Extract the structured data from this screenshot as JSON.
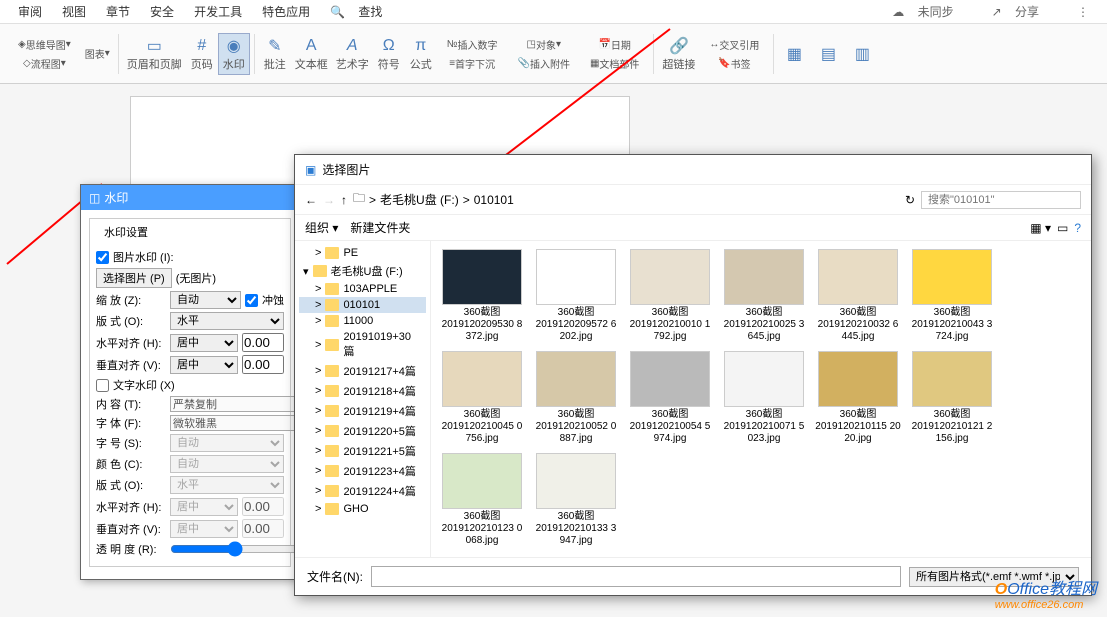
{
  "menu": {
    "items": [
      "审阅",
      "视图",
      "章节",
      "安全",
      "开发工具",
      "特色应用"
    ],
    "search": "查找",
    "right": [
      "未同步",
      "分享"
    ]
  },
  "toolbar": {
    "mindmap": "思维导图",
    "flowchart": "流程图",
    "charts": "图表",
    "header_footer": "页眉和页脚",
    "page_number": "页码",
    "watermark": "水印",
    "comment": "批注",
    "textbox": "文本框",
    "wordart": "艺术字",
    "symbol": "符号",
    "equation": "公式",
    "insert_num": "插入数字",
    "first_down": "首字下沉",
    "object": "对象",
    "insert_attach": "插入附件",
    "date": "日期",
    "doc_part": "文档部件",
    "hyperlink": "超链接",
    "cross_ref": "交叉引用",
    "bookmark": "书签"
  },
  "watermark_dialog": {
    "title": "水印",
    "settings_label": "水印设置",
    "img_watermark": "图片水印 (I):",
    "select_img": "选择图片 (P)",
    "no_img": "(无图片)",
    "scale": "缩 放 (Z):",
    "scale_val": "自动",
    "wash": "冲蚀",
    "layout": "版 式 (O):",
    "layout_val": "水平",
    "h_align": "水平对齐 (H):",
    "h_align_val": "居中",
    "h_offset": "0.00",
    "v_align": "垂直对齐 (V):",
    "v_align_val": "居中",
    "v_offset": "0.00",
    "txt_watermark": "文字水印 (X)",
    "content": "内 容 (T):",
    "content_val": "严禁复制",
    "font": "字 体 (F):",
    "font_val": "微软雅黑",
    "fontsize": "字 号 (S):",
    "fontsize_val": "自动",
    "color": "颜 色 (C):",
    "color_val": "自动",
    "layout2": "版 式 (O):",
    "layout2_val": "水平",
    "h_align2": "水平对齐 (H):",
    "h_align2_val": "居中",
    "h_offset2": "0.00",
    "v_align2": "垂直对齐 (V):",
    "v_align2_val": "居中",
    "v_offset2": "0.00",
    "opacity": "透 明 度 (R):"
  },
  "file_dialog": {
    "title": "选择图片",
    "path": [
      "老毛桃U盘 (F:)",
      "010101"
    ],
    "search_placeholder": "搜索\"010101\"",
    "organize": "组织",
    "new_folder": "新建文件夹",
    "tree": [
      {
        "label": "PE",
        "level": 1
      },
      {
        "label": "老毛桃U盘 (F:)",
        "level": 0,
        "root": true
      },
      {
        "label": "103APPLE",
        "level": 1
      },
      {
        "label": "010101",
        "level": 1,
        "selected": true
      },
      {
        "label": "11000",
        "level": 1
      },
      {
        "label": "20191019+30篇",
        "level": 1
      },
      {
        "label": "20191217+4篇",
        "level": 1
      },
      {
        "label": "20191218+4篇",
        "level": 1
      },
      {
        "label": "20191219+4篇",
        "level": 1
      },
      {
        "label": "20191220+5篇",
        "level": 1
      },
      {
        "label": "20191221+5篇",
        "level": 1
      },
      {
        "label": "20191223+4篇",
        "level": 1
      },
      {
        "label": "20191224+4篇",
        "level": 1
      },
      {
        "label": "GHO",
        "level": 1
      }
    ],
    "files": [
      {
        "title": "360截图",
        "name": "2019120209530 8372.jpg",
        "bg": "#1c2a38"
      },
      {
        "title": "360截图",
        "name": "2019120209572 6202.jpg",
        "bg": "#fff"
      },
      {
        "title": "360截图",
        "name": "2019120210010 1792.jpg",
        "bg": "#e8e0d0"
      },
      {
        "title": "360截图",
        "name": "2019120210025 3645.jpg",
        "bg": "#d4c8b0"
      },
      {
        "title": "360截图",
        "name": "2019120210032 6445.jpg",
        "bg": "#e8dcc4"
      },
      {
        "title": "360截图",
        "name": "2019120210043 3724.jpg",
        "bg": "#ffd740"
      },
      {
        "title": "360截图",
        "name": "2019120210045 0756.jpg",
        "bg": "#e6d8bc"
      },
      {
        "title": "360截图",
        "name": "2019120210052 0887.jpg",
        "bg": "#d6c8a8"
      },
      {
        "title": "360截图",
        "name": "2019120210054 5974.jpg",
        "bg": "#bababa"
      },
      {
        "title": "360截图",
        "name": "2019120210071 5023.jpg",
        "bg": "#f4f4f4"
      },
      {
        "title": "360截图",
        "name": "2019120210115 2020.jpg",
        "bg": "#d2b060"
      },
      {
        "title": "360截图",
        "name": "2019120210121 2156.jpg",
        "bg": "#e0c880"
      },
      {
        "title": "360截图",
        "name": "2019120210123 0068.jpg",
        "bg": "#d8e8c8"
      },
      {
        "title": "360截图",
        "name": "2019120210133 3947.jpg",
        "bg": "#f0f0e8"
      }
    ],
    "filename_label": "文件名(N):",
    "filter": "所有图片格式(*.emf *.wmf *.jp"
  },
  "logo": {
    "text": "Office",
    "suffix": "教程网",
    "url": "www.office26.com"
  }
}
